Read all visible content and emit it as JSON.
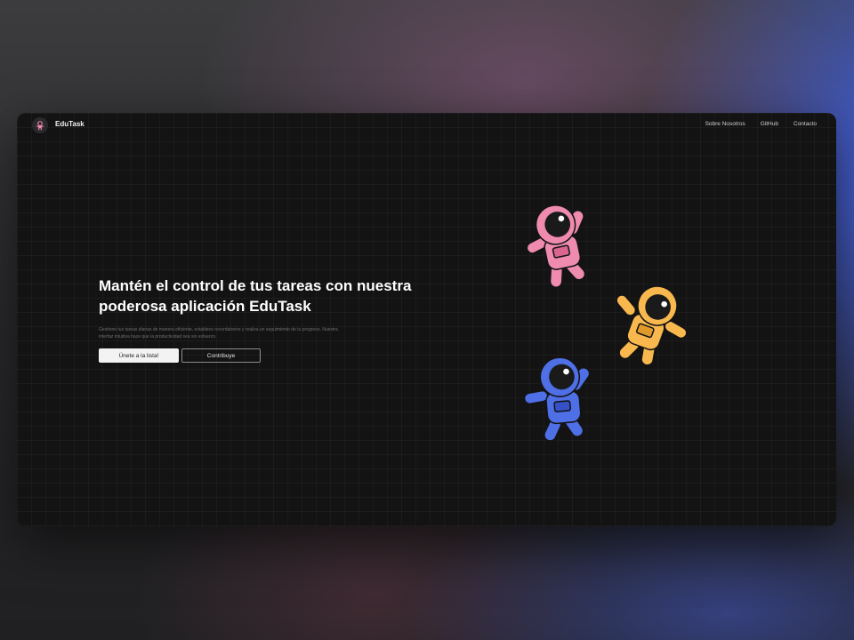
{
  "navbar": {
    "brand": "EduTask",
    "links": [
      "Sobre Nosotros",
      "GitHub",
      "Contacto"
    ]
  },
  "hero": {
    "title": "Mantén el control de tus tareas con nuestra poderosa aplicación EduTask",
    "description": "Gestione tus tareas diarias de manera eficiente, establece recordatorios y realiza un seguimiento de tu progreso. Nuestra interfaz intuitiva hace que la productividad sea sin esfuerzo.",
    "primary_button": "Únete a la lista!",
    "secondary_button": "Contribuye"
  },
  "illustration": {
    "astronauts": [
      {
        "color_name": "pink",
        "suit": "#f08bb0",
        "shade": "#d9668f"
      },
      {
        "color_name": "orange",
        "suit": "#f8b84e",
        "shade": "#e09a2c"
      },
      {
        "color_name": "blue",
        "suit": "#4f6fe6",
        "shade": "#3551c7"
      }
    ]
  },
  "colors": {
    "window_bg": "#131314",
    "text_primary": "#ffffff",
    "text_muted": "#6f6f72",
    "button_primary_bg": "#f3f3f3"
  }
}
